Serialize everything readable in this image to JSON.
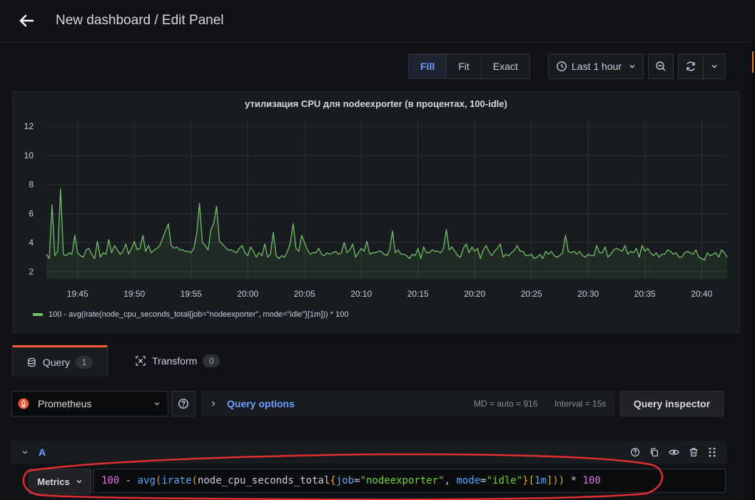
{
  "header": {
    "title": "New dashboard / Edit Panel"
  },
  "toolbar": {
    "display_modes": [
      "Fill",
      "Fit",
      "Exact"
    ],
    "active_mode": "Fill",
    "time_range": "Last 1 hour"
  },
  "panel": {
    "title": "утилизация CPU для nodeexporter (в процентах, 100-idle)",
    "legend": "100 - avg(irate(node_cpu_seconds_total{job=\"nodeexporter\", mode=\"idle\"}[1m])) * 100",
    "series_color": "#73bf69"
  },
  "chart_data": {
    "type": "area",
    "title": "утилизация CPU для nodeexporter (в процентах, 100-idle)",
    "xlabel": "",
    "ylabel": "",
    "x_ticks": [
      "19:45",
      "19:50",
      "19:55",
      "20:00",
      "20:05",
      "20:10",
      "20:15",
      "20:20",
      "20:25",
      "20:30",
      "20:35",
      "20:40"
    ],
    "y_ticks": [
      2,
      4,
      6,
      8,
      10,
      12
    ],
    "xlim": [
      "19:42:15",
      "20:42:15"
    ],
    "ylim": [
      1.5,
      12.5
    ],
    "grid": true,
    "legend_position": "bottom-left",
    "series": [
      {
        "name": "100 - avg(irate(node_cpu_seconds_total{job=\"nodeexporter\", mode=\"idle\"}[1m])) * 100",
        "x_start": "19:42:15",
        "x_step_seconds": 15,
        "values": [
          3.2,
          2.9,
          6.6,
          3.1,
          3.4,
          7.7,
          3.2,
          3.1,
          3.3,
          3.2,
          4.5,
          3.3,
          3.1,
          3.0,
          3.5,
          3.6,
          3.2,
          2.9,
          4.1,
          3.0,
          3.3,
          3.2,
          4.2,
          3.3,
          3.8,
          3.5,
          3.2,
          3.4,
          3.9,
          3.2,
          3.6,
          4.1,
          3.5,
          3.6,
          4.5,
          3.4,
          3.8,
          3.3,
          3.5,
          3.6,
          3.8,
          4.3,
          4.8,
          5.3,
          3.8,
          3.6,
          3.7,
          3.5,
          3.5,
          3.4,
          3.4,
          3.3,
          3.6,
          4.6,
          6.7,
          4.0,
          3.8,
          3.5,
          4.9,
          5.3,
          6.5,
          4.1,
          3.9,
          3.7,
          3.5,
          3.5,
          3.4,
          3.3,
          3.6,
          3.8,
          3.3,
          3.1,
          3.7,
          3.4,
          3.0,
          3.3,
          3.1,
          3.9,
          3.0,
          3.2,
          4.7,
          3.1,
          2.9,
          3.1,
          3.0,
          3.4,
          4.0,
          5.3,
          3.6,
          3.4,
          4.5,
          4.0,
          3.5,
          3.2,
          3.3,
          3.3,
          3.6,
          3.2,
          3.1,
          3.3,
          3.2,
          3.3,
          3.4,
          3.2,
          3.3,
          4.0,
          3.3,
          3.5,
          3.9,
          3.0,
          3.3,
          3.6,
          3.4,
          4.1,
          3.2,
          3.3,
          3.3,
          3.4,
          3.4,
          3.2,
          3.1,
          3.5,
          4.8,
          3.3,
          3.5,
          3.2,
          3.2,
          3.1,
          2.9,
          3.2,
          3.1,
          3.6,
          2.9,
          3.7,
          3.3,
          3.3,
          3.5,
          3.4,
          3.4,
          3.3,
          3.6,
          4.9,
          3.5,
          3.7,
          3.4,
          3.1,
          3.0,
          3.6,
          3.9,
          3.3,
          3.7,
          3.4,
          3.6,
          2.9,
          3.5,
          3.8,
          3.4,
          3.1,
          3.4,
          3.6,
          3.9,
          3.0,
          3.2,
          3.1,
          3.3,
          3.5,
          3.8,
          3.4,
          3.4,
          3.1,
          3.1,
          3.2,
          2.9,
          3.0,
          3.2,
          2.9,
          3.4,
          3.2,
          3.4,
          3.1,
          3.0,
          3.1,
          3.3,
          4.5,
          3.4,
          3.3,
          3.4,
          3.2,
          3.4,
          3.1,
          3.0,
          3.2,
          3.1,
          3.1,
          3.8,
          3.3,
          3.3,
          3.7,
          3.0,
          3.2,
          3.5,
          3.6,
          3.5,
          3.4,
          3.8,
          3.2,
          3.4,
          3.3,
          3.6,
          3.0,
          3.8,
          3.4,
          3.6,
          3.3,
          3.1,
          3.3,
          3.0,
          3.2,
          3.2,
          3.5,
          3.4,
          3.2,
          3.3,
          3.0,
          3.0,
          3.3,
          3.4,
          3.3,
          3.2,
          3.5,
          3.0,
          2.9,
          2.8,
          3.3,
          3.1,
          3.2,
          3.3,
          3.0,
          3.5,
          3.3,
          3.0,
          3.5,
          3.7,
          3.1,
          3.8,
          4.2,
          3.4,
          3.6,
          3.4,
          3.3,
          3.1,
          3.4,
          4.4,
          4.1,
          3.4,
          3.7,
          4.4,
          3.4,
          3.9,
          3.2,
          3.3,
          3.5,
          3.4,
          3.1,
          2.9,
          3.5,
          3.6,
          3.2,
          3.4,
          3.1,
          3.3,
          3.2,
          3.0,
          3.5,
          3.1,
          3.6,
          3.2,
          3.3,
          3.1,
          3.2,
          3.5,
          3.7,
          3.3,
          3.4,
          3.1,
          3.3,
          3.8,
          3.2,
          3.6,
          3.9,
          3.4,
          3.5,
          3.2,
          3.1,
          3.4,
          3.6,
          3.3,
          3.4,
          3.2,
          3.0,
          3.3,
          3.8,
          3.4,
          3.2,
          3.5,
          3.6,
          3.3,
          3.4,
          3.8,
          3.6,
          3.5,
          3.3,
          3.3,
          3.4,
          3.8,
          3.1,
          3.2,
          3.3,
          3.4,
          3.0,
          3.3,
          3.2,
          3.7,
          3.4,
          3.4,
          3.0,
          3.3,
          3.5,
          3.2,
          3.3,
          3.7,
          3.8
        ]
      }
    ]
  },
  "tabs": [
    {
      "label": "Query",
      "count": "1"
    },
    {
      "label": "Transform",
      "count": "0"
    }
  ],
  "query_editor": {
    "datasource": "Prometheus",
    "query_options_label": "Query options",
    "md_info": "MD = auto = 916",
    "interval_info": "Interval = 15s",
    "inspector_label": "Query inspector",
    "query_ref": "A",
    "metrics_label": "Metrics",
    "expr": "100 - avg(irate(node_cpu_seconds_total{job=\"nodeexporter\", mode=\"idle\"}[1m])) * 100"
  },
  "colors": {
    "accent": "#3871dc",
    "tab_active": "#f55f3e",
    "annotation_red": "#e02f2f",
    "series": "#73bf69"
  }
}
